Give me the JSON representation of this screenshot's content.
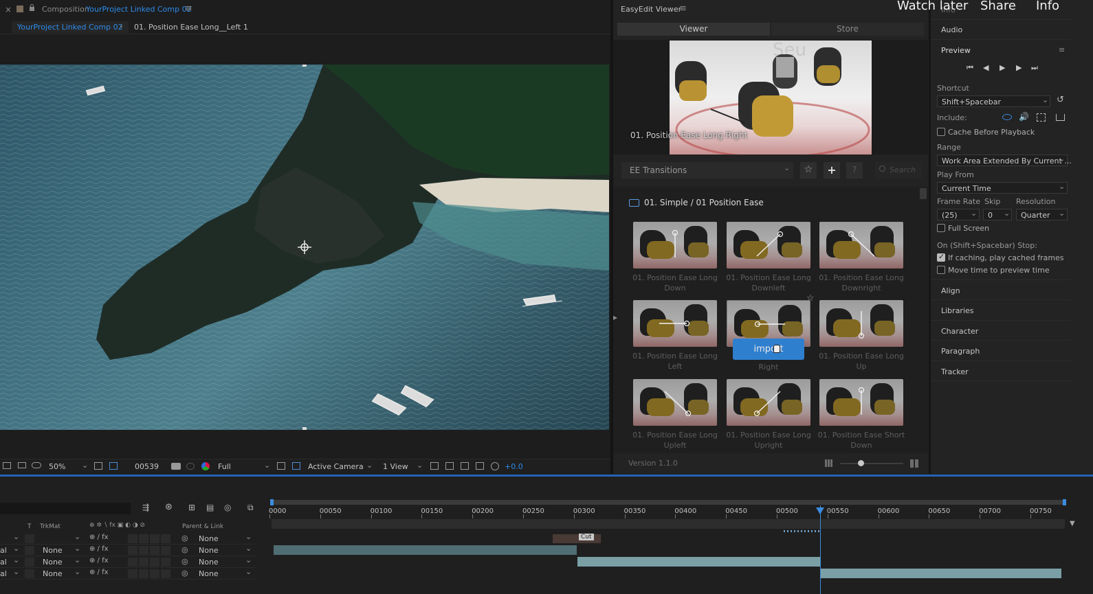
{
  "comp_header": {
    "close": "×",
    "prefix": "Composition",
    "comp_name": "YourProject Linked Comp 02",
    "menu": "≡",
    "breadcrumb_active": "YourProject Linked Comp 02",
    "breadcrumb_next": "01. Position Ease Long__Left 1"
  },
  "viewer_toolbar": {
    "zoom": "50%",
    "timecode": "00539",
    "resolution": "Full",
    "camera": "Active Camera",
    "views": "1 View",
    "exposure": "+0.0"
  },
  "easyedit": {
    "title": "EasyEdit Viewer",
    "menu": "≡",
    "tabs": [
      {
        "label": "Viewer"
      },
      {
        "label": "Store"
      }
    ],
    "preview_caption": "01. Position Ease Long Right",
    "category": "EE Transitions",
    "search_placeholder": "Search",
    "help": "?",
    "folder": "01. Simple / 01 Position Ease",
    "items": [
      {
        "label": "01. Position Ease Long Down",
        "arrow": "down"
      },
      {
        "label": "01. Position Ease Long Downleft",
        "arrow": "downleft"
      },
      {
        "label": "01. Position Ease Long Downright",
        "arrow": "downright"
      },
      {
        "label": "01. Position Ease Long Left",
        "arrow": "left"
      },
      {
        "label": "Right",
        "arrow": "right"
      },
      {
        "label": "01. Position Ease Long Up",
        "arrow": "up"
      },
      {
        "label": "01. Position Ease Long Upleft",
        "arrow": "upleft"
      },
      {
        "label": "01. Position Ease Long Upright",
        "arrow": "upright"
      },
      {
        "label": "01. Position Ease Short Down",
        "arrow": "down"
      }
    ],
    "import_button": "import",
    "version": "Version 1.1.0"
  },
  "overlay": {
    "watch_later": "Watch later",
    "share": "Share",
    "info": "Info"
  },
  "right_panel": {
    "top_item": "Info",
    "audio": "Audio",
    "preview": "Preview",
    "shortcut_label": "Shortcut",
    "shortcut_value": "Shift+Spacebar",
    "include_label": "Include:",
    "cache_before": "Cache Before Playback",
    "range_label": "Range",
    "range_value": "Work Area Extended By Current ...",
    "play_from_label": "Play From",
    "play_from_value": "Current Time",
    "frame_rate_label": "Frame Rate",
    "skip_label": "Skip",
    "resolution_label": "Resolution",
    "frame_rate_value": "(25)",
    "skip_value": "0",
    "resolution_value": "Quarter",
    "full_screen": "Full Screen",
    "stop_label": "On (Shift+Spacebar) Stop:",
    "if_caching": "If caching, play cached frames",
    "move_time": "Move time to preview time",
    "sections": [
      "Align",
      "Libraries",
      "Character",
      "Paragraph",
      "Tracker"
    ]
  },
  "timeline": {
    "ruler": [
      "0000",
      "00050",
      "00100",
      "00150",
      "00200",
      "00250",
      "00300",
      "00350",
      "00400",
      "00450",
      "00500",
      "00550",
      "00600",
      "00650",
      "00700",
      "00750"
    ],
    "col_t": "T",
    "col_trkmat": "TrkMat",
    "col_parent": "Parent & Link",
    "marker": "Cut",
    "rows": [
      {
        "mode": "",
        "trkmat": "",
        "parent": "None"
      },
      {
        "mode": "al",
        "trkmat": "None",
        "parent": "None"
      },
      {
        "mode": "al",
        "trkmat": "None",
        "parent": "None"
      },
      {
        "mode": "al",
        "trkmat": "None",
        "parent": "None"
      }
    ]
  }
}
